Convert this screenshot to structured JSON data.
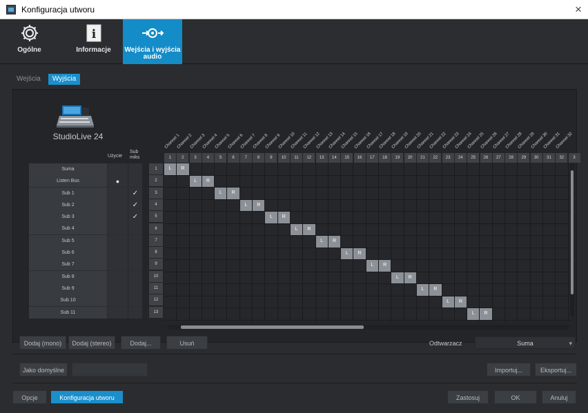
{
  "window": {
    "title": "Konfiguracja utworu",
    "close": "×"
  },
  "nav": {
    "tabs": [
      {
        "label": "Ogólne",
        "icon": "gear-icon"
      },
      {
        "label": "Informacje",
        "icon": "info-icon"
      },
      {
        "label": "Wejścia i wyjścia audio",
        "icon": "audio-io-icon"
      }
    ]
  },
  "subtabs": [
    {
      "label": "Wejścia"
    },
    {
      "label": "Wyjścia"
    }
  ],
  "device": {
    "name": "StudioLive 24"
  },
  "columns": {
    "usage": "Użycie",
    "submix": "Sub miks"
  },
  "channels": [
    "Channel 1",
    "Channel 2",
    "Channel 3",
    "Channel 4",
    "Channel 5",
    "Channel 6",
    "Channel 7",
    "Channel 8",
    "Channel 9",
    "Channel 10",
    "Channel 11",
    "Channel 12",
    "Channel 13",
    "Channel 14",
    "Channel 15",
    "Channel 16",
    "Channel 17",
    "Channel 18",
    "Channel 19",
    "Channel 20",
    "Channel 21",
    "Channel 22",
    "Channel 23",
    "Channel 24",
    "Channel 25",
    "Channel 26",
    "Channel 27",
    "Channel 28",
    "Channel 29",
    "Channel 30",
    "Channel 31",
    "Channel 32"
  ],
  "channel_numbers": [
    "1",
    "2",
    "3",
    "4",
    "5",
    "6",
    "7",
    "8",
    "9",
    "10",
    "11",
    "12",
    "13",
    "14",
    "15",
    "16",
    "17",
    "18",
    "19",
    "20",
    "21",
    "22",
    "23",
    "24",
    "25",
    "26",
    "27",
    "28",
    "29",
    "30",
    "31",
    "32",
    "3"
  ],
  "outputs": [
    {
      "name": "Suma",
      "num": "1",
      "usage": "",
      "submix": ""
    },
    {
      "name": "Listen Bus",
      "num": "2",
      "usage": "●",
      "submix": ""
    },
    {
      "name": "Sub 1",
      "num": "3",
      "usage": "",
      "submix": "✓"
    },
    {
      "name": "Sub 2",
      "num": "4",
      "usage": "",
      "submix": "✓"
    },
    {
      "name": "Sub 3",
      "num": "5",
      "usage": "",
      "submix": "✓"
    },
    {
      "name": "Sub 4",
      "num": "6",
      "usage": "",
      "submix": ""
    },
    {
      "name": "Sub 5",
      "num": "7",
      "usage": "",
      "submix": ""
    },
    {
      "name": "Sub 6",
      "num": "8",
      "usage": "",
      "submix": ""
    },
    {
      "name": "Sub 7",
      "num": "9",
      "usage": "",
      "submix": ""
    },
    {
      "name": "Sub 8",
      "num": "10",
      "usage": "",
      "submix": ""
    },
    {
      "name": "Sub 9",
      "num": "11",
      "usage": "",
      "submix": ""
    },
    {
      "name": "Sub 10",
      "num": "12",
      "usage": "",
      "submix": ""
    },
    {
      "name": "Sub 11",
      "num": "13",
      "usage": "",
      "submix": ""
    }
  ],
  "routing": {
    "L": "L",
    "R": "R"
  },
  "buttons": {
    "add_mono": "Dodaj (mono)",
    "add_stereo": "Dodaj (stereo)",
    "add": "Dodaj...",
    "remove": "Usuń",
    "default": "Jako domyślne",
    "disabled_btn": "",
    "import": "Importuj...",
    "export": "Eksportuj...",
    "options": "Opcje",
    "song_setup": "Konfiguracja utworu",
    "apply": "Zastosuj",
    "ok": "OK",
    "cancel": "Anuluj"
  },
  "player": {
    "label": "Odtwarzacz",
    "value": "Suma"
  },
  "colors": {
    "accent": "#1a8fcb"
  }
}
